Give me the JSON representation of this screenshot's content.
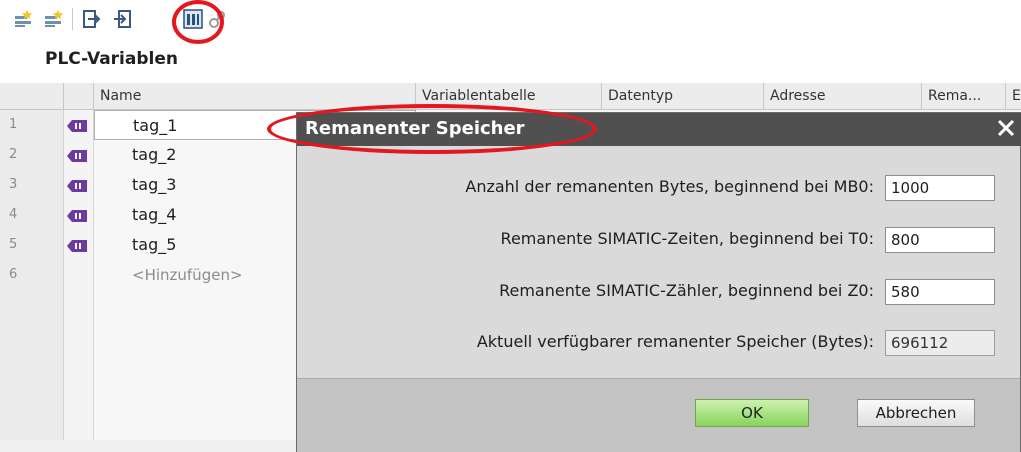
{
  "toolbar": {
    "icons": [
      "add-row-icon",
      "insert-row-icon",
      "export-icon",
      "import-icon",
      "retentive-memory-icon",
      "monitor-icon"
    ]
  },
  "section": {
    "title": "PLC-Variablen"
  },
  "table": {
    "columns": [
      "Name",
      "Variablentabelle",
      "Datentyp",
      "Adresse",
      "Rema...",
      "E"
    ],
    "rows": [
      {
        "num": "1",
        "name": "tag_1"
      },
      {
        "num": "2",
        "name": "tag_2"
      },
      {
        "num": "3",
        "name": "tag_3"
      },
      {
        "num": "4",
        "name": "tag_4"
      },
      {
        "num": "5",
        "name": "tag_5"
      },
      {
        "num": "6",
        "name": "<Hinzufügen>"
      }
    ]
  },
  "dialog": {
    "title": "Remanenter Speicher",
    "close": "✕",
    "fields": [
      {
        "label": "Anzahl der remanenten Bytes, beginnend bei MB0:",
        "value": "1000"
      },
      {
        "label": "Remanente SIMATIC-Zeiten, beginnend bei T0:",
        "value": "800"
      },
      {
        "label": "Remanente SIMATIC-Zähler, beginnend bei Z0:",
        "value": "580"
      },
      {
        "label": "Aktuell verfügbarer remanenter Speicher (Bytes):",
        "value": "696112"
      }
    ],
    "ok_label": "OK",
    "cancel_label": "Abbrechen"
  },
  "colors": {
    "dialog_title_bg": "#505050",
    "ok_green": "#86d45a",
    "highlight_red": "#e4161e"
  }
}
